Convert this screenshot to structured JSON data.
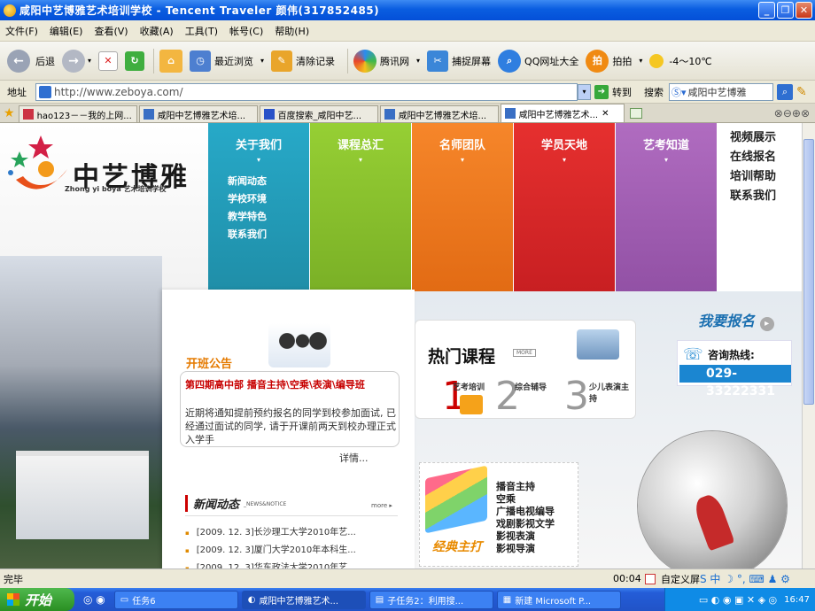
{
  "window": {
    "title": "咸阳中艺博雅艺术培训学校 - Tencent Traveler  颜伟(317852485)"
  },
  "menu": [
    "文件(F)",
    "编辑(E)",
    "查看(V)",
    "收藏(A)",
    "工具(T)",
    "帐号(C)",
    "帮助(H)"
  ],
  "toolbar": {
    "back": "后退",
    "recent": "最近浏览",
    "clear": "清除记录",
    "tencent_net": "腾讯网",
    "capture": "捕捉屏幕",
    "qq_sites": "QQ网址大全",
    "paipai": "拍拍",
    "weather": "-4～10℃"
  },
  "address": {
    "label": "地址",
    "url": "http://www.zeboya.com/",
    "go": "转到",
    "search_label": "搜索",
    "search_value": "咸阳中艺博雅"
  },
  "tabs": [
    {
      "label": "hao123－－我的上网..."
    },
    {
      "label": "咸阳中艺博雅艺术培..."
    },
    {
      "label": "百度搜索_咸阳中艺..."
    },
    {
      "label": "咸阳中艺博雅艺术培..."
    },
    {
      "label": "咸阳中艺博雅艺术...",
      "active": true
    }
  ],
  "site": {
    "logo_cn": "中艺博雅",
    "logo_sub": "Zhong yi boya 艺术培训学校",
    "nav": [
      {
        "label": "关于我们",
        "color": "#27a9c8"
      },
      {
        "label": "课程总汇",
        "color": "#8cc630"
      },
      {
        "label": "名师团队",
        "color": "#f07a1d"
      },
      {
        "label": "学员天地",
        "color": "#e0262a"
      },
      {
        "label": "艺考知道",
        "color": "#a85fb8"
      }
    ],
    "about_sub": [
      "新闻动态",
      "学校环境",
      "教学特色",
      "联系我们"
    ],
    "right_links": [
      "视频展示",
      "在线报名",
      "培训帮助",
      "联系我们"
    ],
    "notice": {
      "title": "开班公告",
      "headline": "第四期高中部  播音主持\\空乘\\表演\\编导班",
      "text": "近期将通知提前预约报名的同学到校参加面试, 已经通过面试的同学, 请于开课前两天到校办理正式入学手",
      "more": "详情..."
    },
    "news": {
      "title": "新闻动态",
      "title_en": "_NEWS&NOTICE",
      "more": "more ▸",
      "items": [
        "[2009. 12. 3]长沙理工大学2010年艺...",
        "[2009. 12. 3]厦门大学2010年本科生...",
        "[2009. 12. 3]华东政法大学2010年艺..."
      ]
    },
    "hot": {
      "title": "热门课程",
      "more": "MORE",
      "items": [
        {
          "num": "1",
          "label": "艺考培训"
        },
        {
          "num": "2",
          "label": "综合辅导"
        },
        {
          "num": "3",
          "label": "少儿表演主持"
        }
      ]
    },
    "classic": {
      "title": "经典主打",
      "items": [
        "播音主持",
        "空乘",
        "广播电视编导",
        "戏剧影视文学",
        "影视表演",
        "影视导演"
      ]
    },
    "signup": "我要报名",
    "hotline": {
      "label": "咨询热线:",
      "number": "029-33222331"
    }
  },
  "status": {
    "text": "完毕",
    "time": "00:04",
    "zoom": "自定义屏"
  },
  "taskbar": {
    "start": "开始",
    "items": [
      "任务6",
      "咸阳中艺博雅艺术...",
      "子任务2：利用搜...",
      "新建 Microsoft P..."
    ],
    "clock": "16:47"
  }
}
